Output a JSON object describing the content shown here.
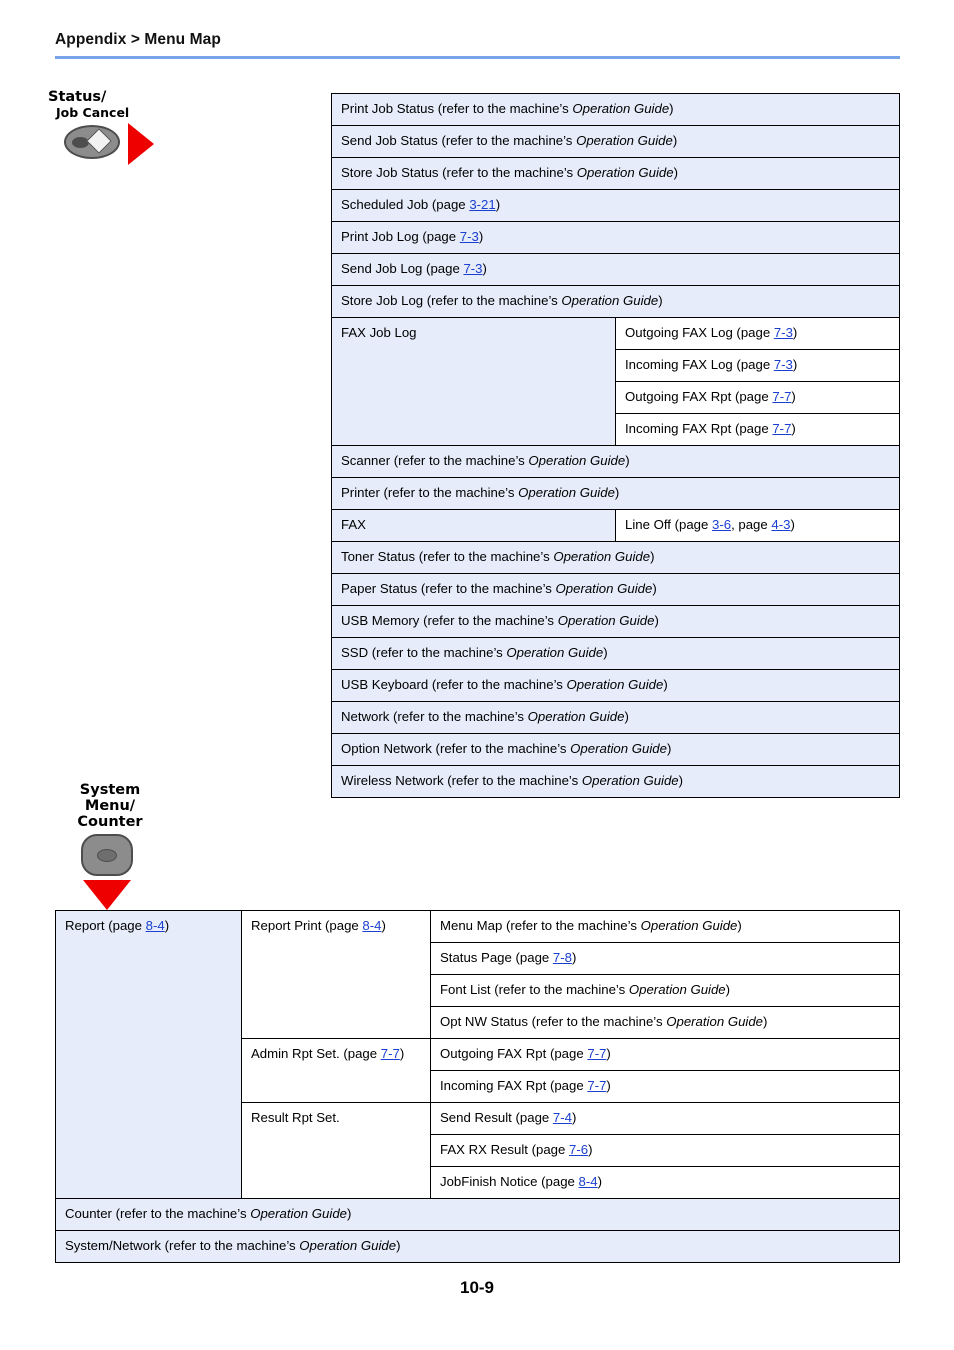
{
  "header": {
    "breadcrumb": "Appendix > Menu Map",
    "rule_color": "#79a3e8"
  },
  "keys": {
    "status": {
      "label_line1": "Status/",
      "label_line2": "Job Cancel",
      "icon": "status-job-cancel-key",
      "arrow": "red-right-arrow"
    },
    "system_menu": {
      "label_line1": "System Menu/",
      "label_line2": "Counter",
      "icon": "system-menu-counter-key",
      "arrow": "red-down-arrow"
    }
  },
  "link_color": "#1a3fd0",
  "cell_fill_blue": "#e6ecfa",
  "status_table": {
    "rows": [
      {
        "span": true,
        "col1": "Print Job Status (refer to the machine’s ",
        "col1_italic": "Operation Guide",
        "col1_tail": ")"
      },
      {
        "span": true,
        "col1": "Send Job Status (refer to the machine’s ",
        "col1_italic": "Operation Guide",
        "col1_tail": ")"
      },
      {
        "span": true,
        "col1": "Store Job Status (refer to the machine’s ",
        "col1_italic": "Operation Guide",
        "col1_tail": ")"
      },
      {
        "span": true,
        "col1": "Scheduled Job (page ",
        "col1_link": "3-21",
        "col1_tail": ")"
      },
      {
        "span": true,
        "col1": "Print Job Log (page ",
        "col1_link": "7-3",
        "col1_tail": ")"
      },
      {
        "span": true,
        "col1": "Send Job Log (page ",
        "col1_link": "7-3",
        "col1_tail": ")"
      },
      {
        "span": true,
        "col1": "Store Job Log (refer to the machine’s ",
        "col1_italic": "Operation Guide",
        "col1_tail": ")"
      }
    ],
    "fax_job_log": {
      "label": "FAX Job Log",
      "children": [
        {
          "text": "Outgoing FAX Log (page ",
          "link": "7-3",
          "tail": ")"
        },
        {
          "text": "Incoming FAX Log (page ",
          "link": "7-3",
          "tail": ")"
        },
        {
          "text": "Outgoing FAX Rpt (page ",
          "link": "7-7",
          "tail": ")"
        },
        {
          "text": "Incoming FAX Rpt (page ",
          "link": "7-7",
          "tail": ")"
        }
      ]
    },
    "rows_mid": [
      {
        "col1": "Scanner (refer to the machine’s ",
        "col1_italic": "Operation Guide",
        "col1_tail": ")"
      },
      {
        "col1": "Printer (refer to the machine’s ",
        "col1_italic": "Operation Guide",
        "col1_tail": ")"
      }
    ],
    "fax": {
      "label": "FAX",
      "child_text": "Line Off (page ",
      "child_link1": "3-6",
      "child_mid": ", page ",
      "child_link2": "4-3",
      "child_tail": ")"
    },
    "rows_end": [
      {
        "col1": "Toner Status (refer to the machine’s ",
        "col1_italic": "Operation Guide",
        "col1_tail": ")"
      },
      {
        "col1": "Paper Status (refer to the machine’s ",
        "col1_italic": "Operation Guide",
        "col1_tail": ")"
      },
      {
        "col1": "USB Memory (refer to the machine’s ",
        "col1_italic": "Operation Guide",
        "col1_tail": ")"
      },
      {
        "col1": "SSD (refer to the machine’s ",
        "col1_italic": "Operation Guide",
        "col1_tail": ")"
      },
      {
        "col1": "USB Keyboard (refer to the machine’s ",
        "col1_italic": "Operation Guide",
        "col1_tail": ")"
      },
      {
        "col1": "Network (refer to the machine’s ",
        "col1_italic": "Operation Guide",
        "col1_tail": ")"
      },
      {
        "col1": "Option Network (refer to the machine’s ",
        "col1_italic": "Operation Guide",
        "col1_tail": ")"
      },
      {
        "col1": "Wireless Network (refer to the machine’s ",
        "col1_italic": "Operation Guide",
        "col1_tail": ")"
      }
    ]
  },
  "system_menu_table": {
    "report": {
      "label_text": "Report (page ",
      "label_link": "8-4",
      "label_tail": ")"
    },
    "report_print": {
      "label_text": "Report Print (page ",
      "label_link": "8-4",
      "label_tail": ")",
      "children": [
        {
          "text": "Menu Map (refer to the machine’s ",
          "italic": "Operation Guide",
          "tail": ")"
        },
        {
          "text": "Status Page (page ",
          "link": "7-8",
          "tail": ")"
        },
        {
          "text": "Font List (refer to the machine’s ",
          "italic": "Operation Guide",
          "tail": ")"
        },
        {
          "text": "Opt NW Status (refer to the machine’s ",
          "italic": "Operation Guide",
          "tail": ")"
        }
      ]
    },
    "admin_rpt_set": {
      "label_text": "Admin Rpt Set. (page ",
      "label_link": "7-7",
      "label_tail": ")",
      "children": [
        {
          "text": "Outgoing FAX Rpt (page ",
          "link": "7-7",
          "tail": ")"
        },
        {
          "text": "Incoming FAX Rpt (page ",
          "link": "7-7",
          "tail": ")"
        }
      ]
    },
    "result_rpt_set": {
      "label_text": "Result Rpt Set.",
      "children": [
        {
          "text": "Send Result (page ",
          "link": "7-4",
          "tail": ")"
        },
        {
          "text": "FAX RX Result (page ",
          "link": "7-6",
          "tail": ")"
        },
        {
          "text": "JobFinish Notice (page ",
          "link": "8-4",
          "tail": ")"
        }
      ]
    },
    "full_rows": [
      {
        "text": "Counter (refer to the machine’s ",
        "italic": "Operation Guide",
        "tail": ")"
      },
      {
        "text": "System/Network (refer to the machine’s ",
        "italic": "Operation Guide",
        "tail": ")"
      }
    ]
  },
  "footer": {
    "page_number": "10-9"
  }
}
